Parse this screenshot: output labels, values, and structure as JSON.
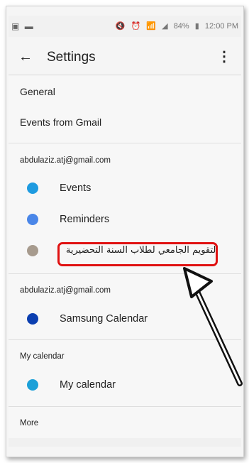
{
  "status_bar": {
    "left_icons": [
      "image-icon",
      "media-icon"
    ],
    "right_icons": [
      "mute-icon",
      "alarm-icon",
      "wifi-icon",
      "signal-icon"
    ],
    "battery": "84%",
    "time": "12:00 PM"
  },
  "app_bar": {
    "back_icon": "arrow-back-icon",
    "title": "Settings",
    "more_icon": "more-vert-icon"
  },
  "settings": {
    "general": "General",
    "events_from_gmail": "Events from Gmail"
  },
  "account_1": {
    "header": "abdulaziz.atj@gmail.com",
    "calendars": [
      {
        "label": "Events",
        "color": "#1e9be0"
      },
      {
        "label": "Reminders",
        "color": "#4a86e8"
      },
      {
        "label": "التقويم الجامعي لطلاب السنة التحضيرية",
        "color": "#a79b8e"
      }
    ]
  },
  "account_2": {
    "header": "abdulaziz.atj@gmail.com",
    "calendars": [
      {
        "label": "Samsung Calendar",
        "color": "#0b3fb0"
      }
    ]
  },
  "my_calendar": {
    "header": "My calendar",
    "calendars": [
      {
        "label": "My calendar",
        "color": "#1ba0d8"
      }
    ]
  },
  "more": {
    "header": "More"
  },
  "annotation": {
    "highlight_color": "#e01111",
    "arrow_color": "#111111"
  }
}
